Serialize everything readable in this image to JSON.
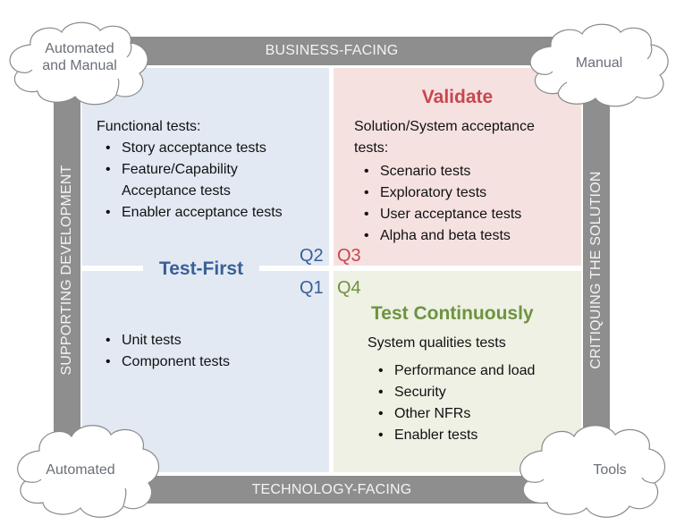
{
  "frame": {
    "top_label": "BUSINESS-FACING",
    "bottom_label": "TECHNOLOGY-FACING",
    "left_label": "SUPPORTING DEVELOPMENT",
    "right_label": "CRITIQUING THE SOLUTION",
    "bar_color": "#8e8e8e"
  },
  "clouds": {
    "top_left": {
      "line1": "Automated",
      "line2": "and Manual"
    },
    "top_right": {
      "text": "Manual"
    },
    "bottom_left": {
      "text": "Automated"
    },
    "bottom_right": {
      "text": "Tools"
    }
  },
  "quadrants": {
    "q2": {
      "label": "Q2",
      "color": "#e2e9f3",
      "heading": "Functional tests:",
      "items": [
        "Story acceptance tests",
        "Feature/Capability",
        "Acceptance tests",
        "Enabler acceptance tests"
      ]
    },
    "q3": {
      "label": "Q3",
      "color": "#f6e1e1",
      "title": "Validate",
      "heading_line1": "Solution/System acceptance",
      "heading_line2": "tests:",
      "items": [
        "Scenario tests",
        "Exploratory tests",
        "User acceptance tests",
        "Alpha and beta tests"
      ]
    },
    "q1": {
      "label": "Q1",
      "color": "#e2e9f3",
      "items": [
        "Unit tests",
        "Component tests"
      ]
    },
    "q4": {
      "label": "Q4",
      "color": "#eef1e4",
      "title": "Test Continuously",
      "heading": "System qualities tests",
      "items": [
        "Performance and load",
        "Security",
        "Other NFRs",
        "Enabler tests"
      ]
    },
    "left_title": "Test-First"
  },
  "colors": {
    "blue_accent": "#3a5f97",
    "red_accent": "#c8474e",
    "green_accent": "#6f9240"
  }
}
